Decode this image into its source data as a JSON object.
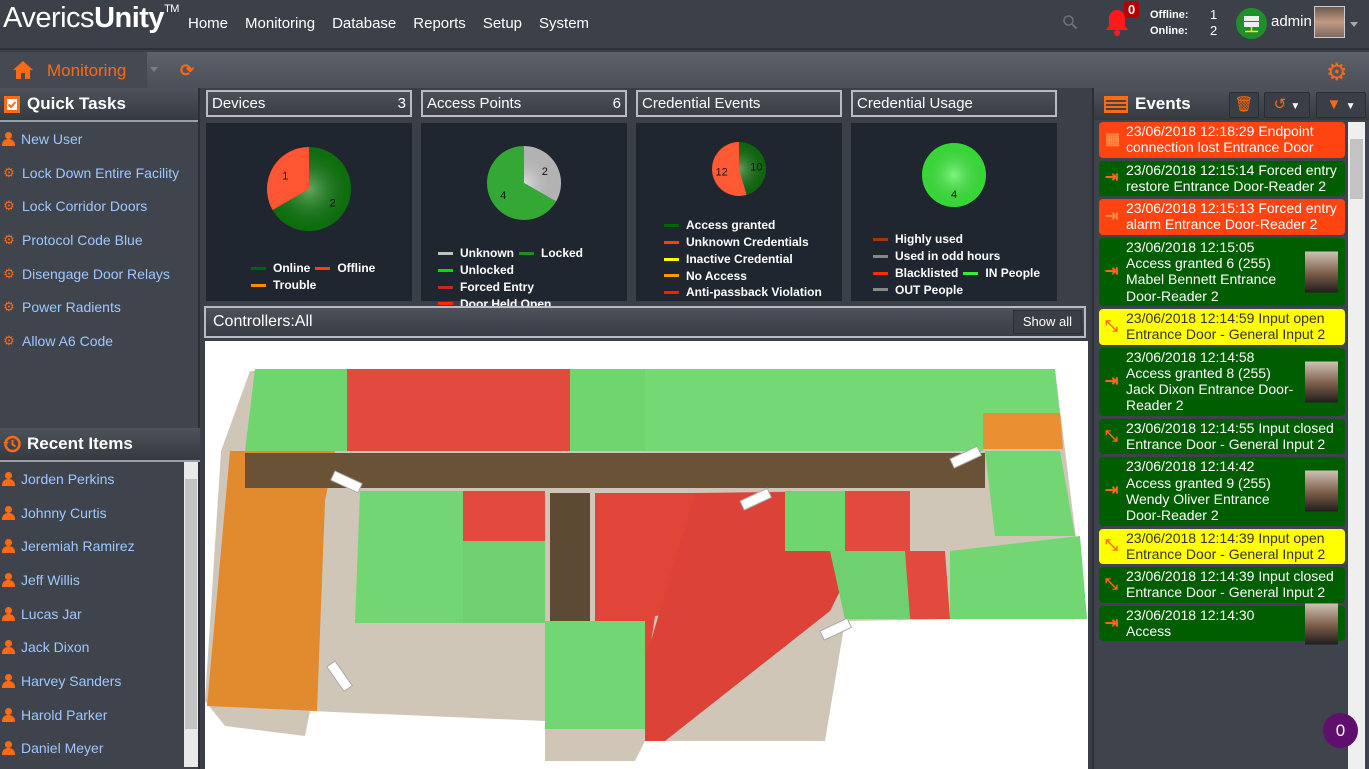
{
  "app": {
    "name_light": "Averics",
    "name_bold": "Unity",
    "trademark": "TM"
  },
  "nav": [
    "Home",
    "Monitoring",
    "Database",
    "Reports",
    "Setup",
    "System"
  ],
  "header": {
    "alerts_count": "0",
    "offline_label": "Offline:",
    "offline_value": "1",
    "online_label": "Online:",
    "online_value": "2",
    "user": "admin"
  },
  "subbar": {
    "section": "Monitoring"
  },
  "quick_tasks": {
    "title": "Quick Tasks",
    "items": [
      {
        "label": "New User",
        "icon": "user-icon"
      },
      {
        "label": "Lock Down Entire Facility",
        "icon": "gears-icon"
      },
      {
        "label": "Lock Corridor Doors",
        "icon": "gears-icon"
      },
      {
        "label": "Protocol Code Blue",
        "icon": "gears-icon"
      },
      {
        "label": "Disengage Door Relays",
        "icon": "gears-icon"
      },
      {
        "label": "Power Radients",
        "icon": "gears-icon"
      },
      {
        "label": "Allow A6 Code",
        "icon": "gears-icon"
      }
    ]
  },
  "recent_items": {
    "title": "Recent Items",
    "items": [
      "Jorden Perkins",
      "Johnny Curtis",
      "Jeremiah Ramirez",
      "Jeff Willis",
      "Lucas Jar",
      "Jack Dixon",
      "Harvey Sanders",
      "Harold Parker",
      "Daniel Meyer"
    ]
  },
  "widgets": [
    {
      "title": "Devices",
      "count": "3",
      "legend": [
        {
          "label": "Online",
          "color": "#006400"
        },
        {
          "label": "Offline",
          "color": "#ff3d0f"
        },
        {
          "label": "Trouble",
          "color": "#ff8c00"
        }
      ]
    },
    {
      "title": "Access Points",
      "count": "6",
      "legend": [
        {
          "label": "Unknown",
          "color": "#c0c0c0"
        },
        {
          "label": "Locked",
          "color": "#228b22"
        },
        {
          "label": "Unlocked",
          "color": "#00e000"
        },
        {
          "label": "Forced Entry",
          "color": "#c62828"
        },
        {
          "label": "Door Held Open",
          "color": "#ff2a00"
        }
      ]
    },
    {
      "title": "Credential Events",
      "count": "",
      "legend": [
        {
          "label": "Access granted",
          "color": "#006400"
        },
        {
          "label": "Unknown Credentials",
          "color": "#ff3d0f"
        },
        {
          "label": "Inactive Credential",
          "color": "#ffff00"
        },
        {
          "label": "No Access",
          "color": "#ff9900"
        },
        {
          "label": "Anti-passback Violation",
          "color": "#ff1a00"
        }
      ]
    },
    {
      "title": "Credential Usage",
      "count": "",
      "legend": [
        {
          "label": "Highly used",
          "color": "#a0380f"
        },
        {
          "label": "Used in odd hours",
          "color": "#888888"
        },
        {
          "label": "Blacklisted",
          "color": "#ff2a00"
        },
        {
          "label": "IN People",
          "color": "#33ee33"
        },
        {
          "label": "OUT People",
          "color": "#888888"
        }
      ]
    }
  ],
  "chart_data": [
    {
      "type": "pie",
      "title": "Devices",
      "categories": [
        "Online",
        "Offline",
        "Trouble"
      ],
      "values": [
        2,
        1,
        0
      ],
      "colors": [
        "#0c7a0c",
        "#ff5533",
        "#ff8c00"
      ]
    },
    {
      "type": "pie",
      "title": "Access Points",
      "categories": [
        "Unknown",
        "Locked",
        "Unlocked",
        "Forced Entry",
        "Door Held Open"
      ],
      "values": [
        2,
        4,
        0,
        0,
        0
      ],
      "colors": [
        "#c8c8c8",
        "#34a834",
        "#00e000",
        "#c62828",
        "#ff2a00"
      ]
    },
    {
      "type": "pie",
      "title": "Credential Events",
      "categories": [
        "Access granted",
        "Unknown Credentials",
        "Inactive Credential",
        "No Access",
        "Anti-passback Violation"
      ],
      "values": [
        10,
        12,
        0,
        0,
        0
      ],
      "colors": [
        "#0f6e0f",
        "#ff5a33",
        "#ffff00",
        "#ff9900",
        "#ff1a00"
      ]
    },
    {
      "type": "pie",
      "title": "Credential Usage",
      "categories": [
        "Highly used",
        "Used in odd hours",
        "Blacklisted",
        "IN People",
        "OUT People"
      ],
      "values": [
        0,
        0,
        0,
        4,
        0
      ],
      "colors": [
        "#a0380f",
        "#888888",
        "#ff2a00",
        "#3cf03c",
        "#888888"
      ]
    }
  ],
  "controllers": {
    "label": "Controllers:All",
    "show_all": "Show all"
  },
  "events": {
    "title": "Events",
    "items": [
      {
        "status": "red",
        "icon": "chip-icon",
        "text": "23/06/2018 12:18:29  Endpoint connection lost  Entrance Door",
        "photo": false
      },
      {
        "status": "green",
        "icon": "door-entry-icon",
        "text": "23/06/2018 12:15:14  Forced entry restore  Entrance Door-Reader 2",
        "photo": false
      },
      {
        "status": "red",
        "icon": "door-entry-icon",
        "text": "23/06/2018 12:15:13  Forced entry alarm  Entrance Door-Reader 2",
        "photo": false
      },
      {
        "status": "green",
        "icon": "door-entry-icon",
        "text": "23/06/2018 12:15:05  Access granted  6 (255)  Mabel Bennett  Entrance Door-Reader 2",
        "photo": true
      },
      {
        "status": "yellow",
        "icon": "input-icon",
        "text": "23/06/2018 12:14:59  Input open  Entrance Door - General Input 2",
        "photo": false
      },
      {
        "status": "green",
        "icon": "door-entry-icon",
        "text": "23/06/2018 12:14:58  Access granted  8 (255)  Jack Dixon  Entrance Door-Reader 2",
        "photo": true
      },
      {
        "status": "green",
        "icon": "input-icon",
        "text": "23/06/2018 12:14:55  Input closed  Entrance Door - General Input 2",
        "photo": false
      },
      {
        "status": "green",
        "icon": "door-entry-icon",
        "text": "23/06/2018 12:14:42  Access granted  9 (255)  Wendy Oliver  Entrance Door-Reader 2",
        "photo": true
      },
      {
        "status": "yellow",
        "icon": "input-icon",
        "text": "23/06/2018 12:14:39  Input open  Entrance Door - General Input 2",
        "photo": false
      },
      {
        "status": "green",
        "icon": "input-icon",
        "text": "23/06/2018 12:14:39  Input closed  Entrance Door - General Input 2",
        "photo": false
      },
      {
        "status": "green",
        "icon": "door-entry-icon",
        "text": "23/06/2018 12:14:30  Access",
        "photo": true
      }
    ]
  },
  "chat_bubble": "0"
}
